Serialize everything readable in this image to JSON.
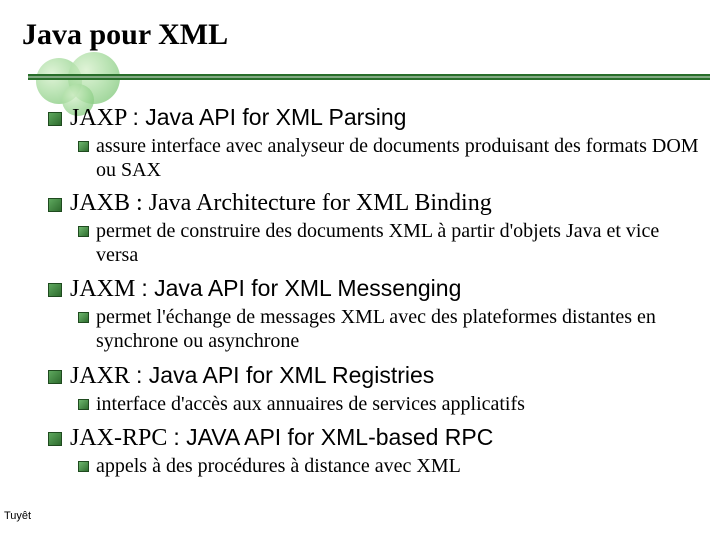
{
  "title": "Java pour XML",
  "items": [
    {
      "heading_html": "JAXP <span class=\"arial\">: Java API for XML Parsing</span>",
      "sub": "assure interface avec analyseur de documents produisant des formats DOM ou SAX"
    },
    {
      "heading_html": "JAXB : Java Architecture for XML Binding",
      "sub": "permet de construire des documents XML à partir d'objets Java et vice versa"
    },
    {
      "heading_html": "JAXM <span class=\"arial\">: Java API for XML Messenging</span>",
      "sub": "permet l'échange de messages XML avec des plateformes distantes en synchrone ou asynchrone"
    },
    {
      "heading_html": "JAXR <span class=\"arial\">: Java API for XML Registries</span>",
      "sub": "interface d'accès aux annuaires de services applicatifs"
    },
    {
      "heading_html": "JAX-RPC <span class=\"arial\">: JAVA API for XML-based RPC</span>",
      "sub": "appels à des procédures à distance avec XML"
    }
  ],
  "footer": "Tuyêt"
}
